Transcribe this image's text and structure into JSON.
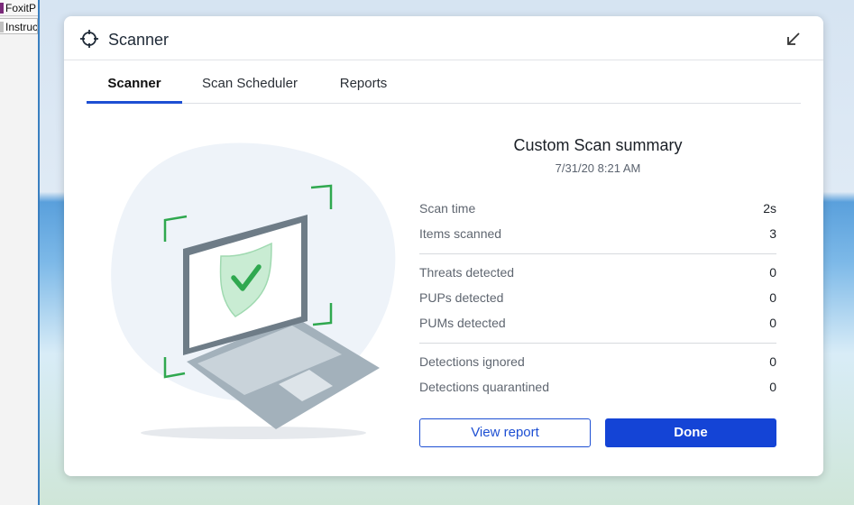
{
  "desktop": {
    "items": [
      "FoxitP",
      "Instruc"
    ]
  },
  "modal": {
    "title": "Scanner",
    "icons": {
      "app": "crosshair-icon",
      "collapse": "arrow-collapse-icon"
    }
  },
  "tabs": [
    {
      "label": "Scanner",
      "active": true
    },
    {
      "label": "Scan Scheduler",
      "active": false
    },
    {
      "label": "Reports",
      "active": false
    }
  ],
  "summary": {
    "title": "Custom Scan summary",
    "date": "7/31/20 8:21 AM",
    "groups": [
      [
        {
          "label": "Scan time",
          "value": "2s"
        },
        {
          "label": "Items scanned",
          "value": "3"
        }
      ],
      [
        {
          "label": "Threats detected",
          "value": "0"
        },
        {
          "label": "PUPs detected",
          "value": "0"
        },
        {
          "label": "PUMs detected",
          "value": "0"
        }
      ],
      [
        {
          "label": "Detections ignored",
          "value": "0"
        },
        {
          "label": "Detections quarantined",
          "value": "0"
        }
      ]
    ]
  },
  "buttons": {
    "view_report": "View report",
    "done": "Done"
  },
  "colors": {
    "accent": "#1d4fd3",
    "shield": "#2fa84f"
  }
}
